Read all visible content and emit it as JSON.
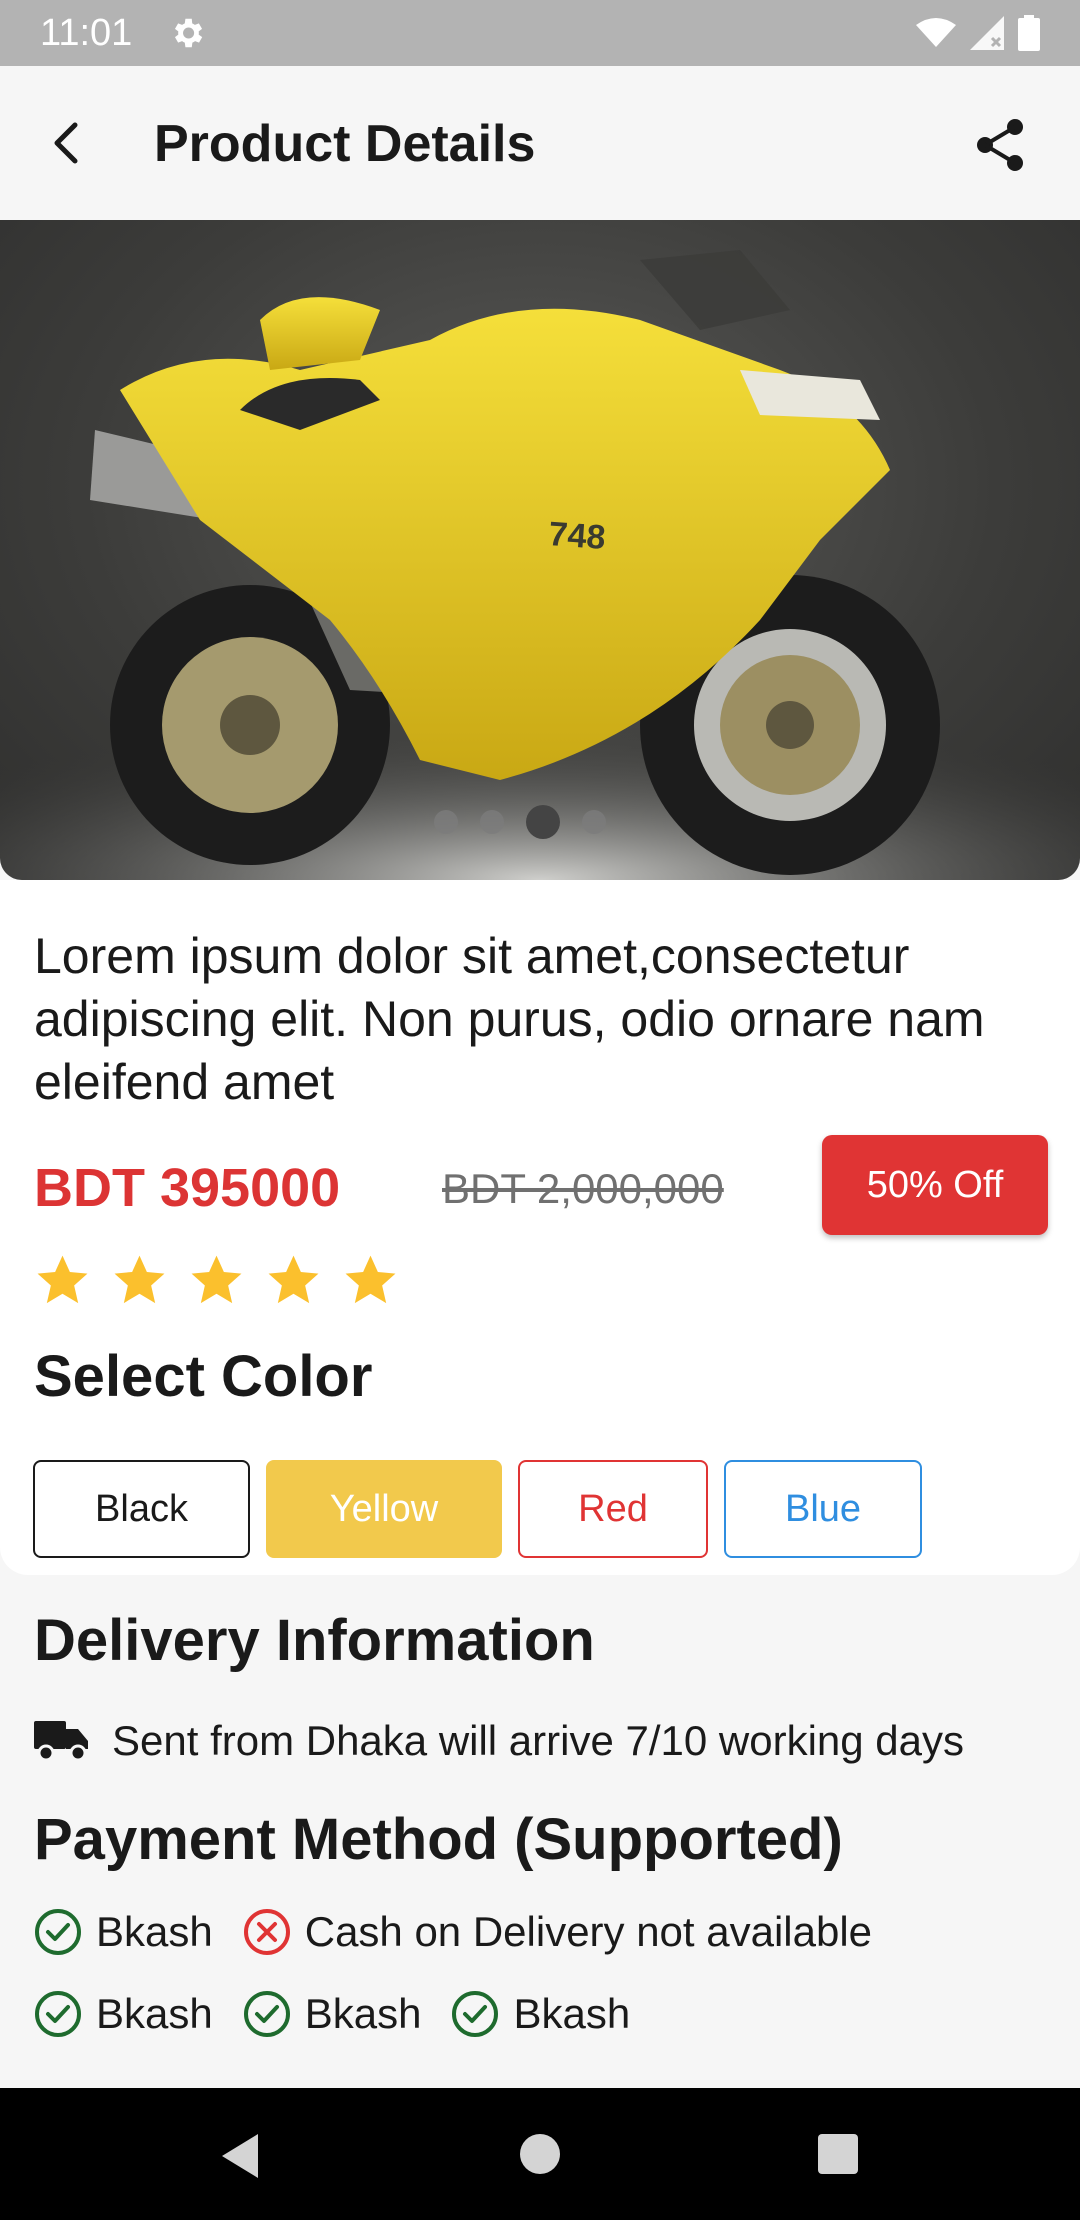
{
  "status_bar": {
    "time": "11:01",
    "icons": [
      "gear-icon",
      "wifi-icon",
      "signal-icon",
      "battery-icon"
    ]
  },
  "app_bar": {
    "title": "Product Details",
    "back_icon": "back-arrow-icon",
    "share_icon": "share-icon"
  },
  "product": {
    "image_subject": "yellow sport motorcycle",
    "image_number_text": "748",
    "carousel": {
      "count": 4,
      "active_index": 2
    },
    "description": "Lorem ipsum dolor sit amet,consectetur adipiscing elit. Non purus, odio ornare nam eleifend amet",
    "price": "BDT 395000",
    "old_price": "BDT 2,000,000",
    "discount": "50% Off",
    "rating": {
      "value": 5,
      "max": 5
    }
  },
  "colors": {
    "title": "Select Color",
    "options": [
      {
        "label": "Black",
        "color": "#1a1a1a"
      },
      {
        "label": "Yellow",
        "color": "#f2c94c",
        "selected": true
      },
      {
        "label": "Red",
        "color": "#e03434"
      },
      {
        "label": "Blue",
        "color": "#2f8ee0"
      }
    ]
  },
  "delivery": {
    "title": "Delivery Information",
    "text": "Sent from Dhaka will arrive 7/10 working days",
    "icon": "truck-icon"
  },
  "payment": {
    "title": "Payment Method (Supported)",
    "rows": [
      [
        {
          "label": "Bkash",
          "supported": true
        },
        {
          "label": "Cash on Delivery not available",
          "supported": false
        }
      ],
      [
        {
          "label": "Bkash",
          "supported": true
        },
        {
          "label": "Bkash",
          "supported": true
        },
        {
          "label": "Bkash",
          "supported": true
        }
      ]
    ]
  },
  "theme": {
    "price_color": "#dc3434",
    "star_color": "#fbc02d",
    "check_color": "#1e6b2e",
    "cross_color": "#e03434"
  }
}
